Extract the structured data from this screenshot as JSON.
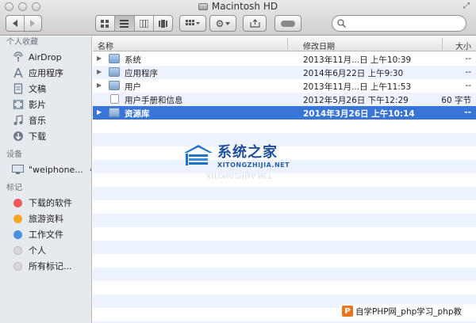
{
  "window": {
    "title": "Macintosh HD"
  },
  "toolbar": {
    "back_icon": "chevron-left-icon",
    "forward_icon": "chevron-right-icon",
    "view_modes": [
      "icon-view-icon",
      "list-view-icon",
      "column-view-icon",
      "coverflow-view-icon"
    ],
    "active_view": "list-view-icon",
    "search_placeholder": ""
  },
  "sidebar": {
    "sections": [
      {
        "heading": "个人收藏",
        "items": [
          {
            "label": "AirDrop",
            "icon": "airdrop-icon"
          },
          {
            "label": "应用程序",
            "icon": "applications-icon"
          },
          {
            "label": "文稿",
            "icon": "documents-icon"
          },
          {
            "label": "影片",
            "icon": "movies-icon"
          },
          {
            "label": "音乐",
            "icon": "music-icon"
          },
          {
            "label": "下载",
            "icon": "downloads-icon"
          }
        ]
      },
      {
        "heading": "设备",
        "items": [
          {
            "label": "\"weiphone...",
            "icon": "computer-icon"
          }
        ]
      },
      {
        "heading": "标记",
        "items": [
          {
            "label": "下载的软件",
            "color": "#f0575a"
          },
          {
            "label": "旅游资料",
            "color": "#f5a623"
          },
          {
            "label": "工作文件",
            "color": "#4a90e2"
          },
          {
            "label": "个人",
            "color": "#d8d8d8"
          },
          {
            "label": "所有标记...",
            "color": "#d8d8d8"
          }
        ]
      }
    ]
  },
  "columns": {
    "name": "名称",
    "date": "修改日期",
    "size": "大小"
  },
  "files": [
    {
      "name": "系统",
      "date": "2013年11月...日 上午10:39",
      "size": "--",
      "type": "folder"
    },
    {
      "name": "应用程序",
      "date": "2014年6月22日 上午9:30",
      "size": "--",
      "type": "folder"
    },
    {
      "name": "用户",
      "date": "2013年11月...日 上午11:53",
      "size": "--",
      "type": "folder"
    },
    {
      "name": "用户手册和信息",
      "date": "2012年5月26日 下午12:29",
      "size": "60 字节",
      "type": "doc"
    },
    {
      "name": "资源库",
      "date": "2014年3月26日 上午10:14",
      "size": "--",
      "type": "folder",
      "selected": true
    }
  ],
  "watermark": {
    "main": "系统之家",
    "sub": "XITONGZHIJIA.NET",
    "bottom": "自学PHP网_php学习_php教"
  }
}
